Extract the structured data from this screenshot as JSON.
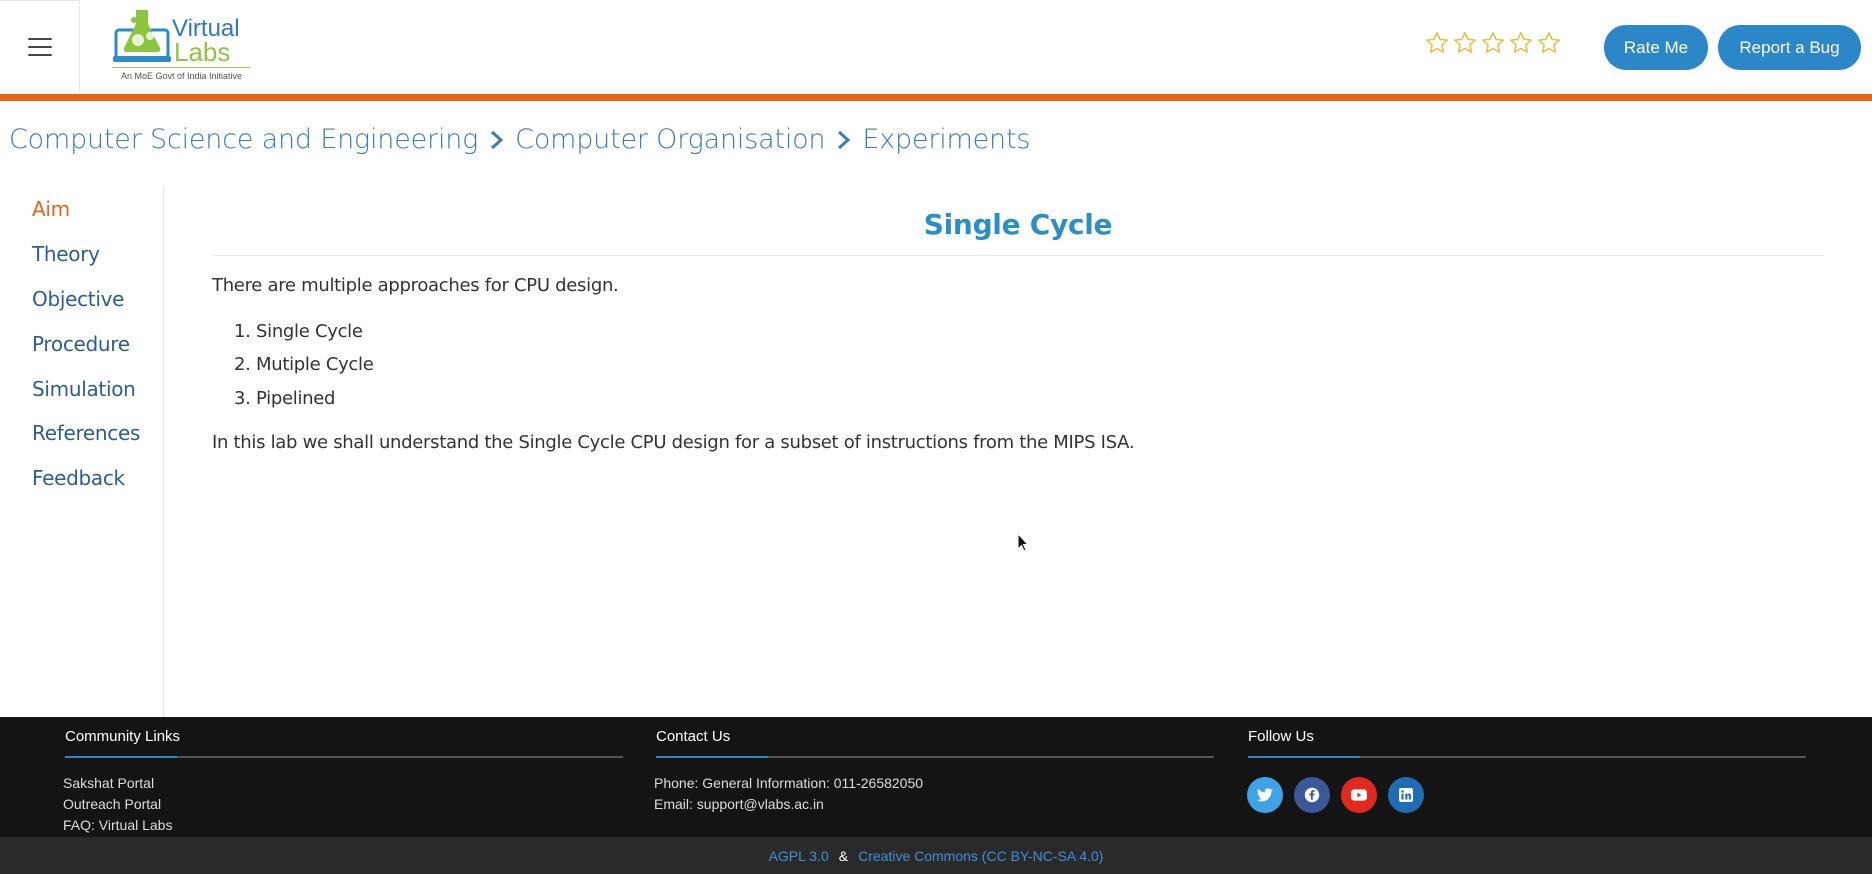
{
  "header": {
    "logo_text_1": "Virtual",
    "logo_text_2": "Labs",
    "logo_tagline": "An MoE Govt of India Initiative",
    "rating_stars": 0,
    "rating_max": 5,
    "rate_button": "Rate Me",
    "bug_button": "Report a Bug"
  },
  "breadcrumb": [
    "Computer Science and Engineering",
    "Computer Organisation",
    "Experiments"
  ],
  "sidebar": {
    "items": [
      {
        "label": "Aim",
        "active": true
      },
      {
        "label": "Theory",
        "active": false
      },
      {
        "label": "Objective",
        "active": false
      },
      {
        "label": "Procedure",
        "active": false
      },
      {
        "label": "Simulation",
        "active": false
      },
      {
        "label": "References",
        "active": false
      },
      {
        "label": "Feedback",
        "active": false
      }
    ]
  },
  "main": {
    "title": "Single Cycle",
    "intro": "There are multiple approaches for CPU design.",
    "list": [
      "1. Single Cycle",
      "2. Mutiple Cycle",
      "3. Pipelined"
    ],
    "conclusion": "In this lab we shall understand the Single Cycle CPU design for a subset of instructions from the MIPS ISA."
  },
  "footer": {
    "community": {
      "heading": "Community Links",
      "links": [
        "Sakshat Portal",
        "Outreach Portal",
        "FAQ: Virtual Labs"
      ]
    },
    "contact": {
      "heading": "Contact Us",
      "phone": "Phone: General Information: 011-26582050",
      "email": "Email: support@vlabs.ac.in"
    },
    "follow": {
      "heading": "Follow Us",
      "icons": [
        "twitter-icon",
        "facebook-icon",
        "youtube-icon",
        "linkedin-icon"
      ]
    },
    "license_1": "AGPL 3.0",
    "license_sep": "&",
    "license_2": "Creative Commons (CC BY-NC-SA 4.0)"
  },
  "colors": {
    "accent_orange": "#e86318",
    "brand_blue": "#2b87c8",
    "title_blue": "#2b8fc7",
    "star_outline": "#e2c14a",
    "footer_bg": "#141414"
  }
}
